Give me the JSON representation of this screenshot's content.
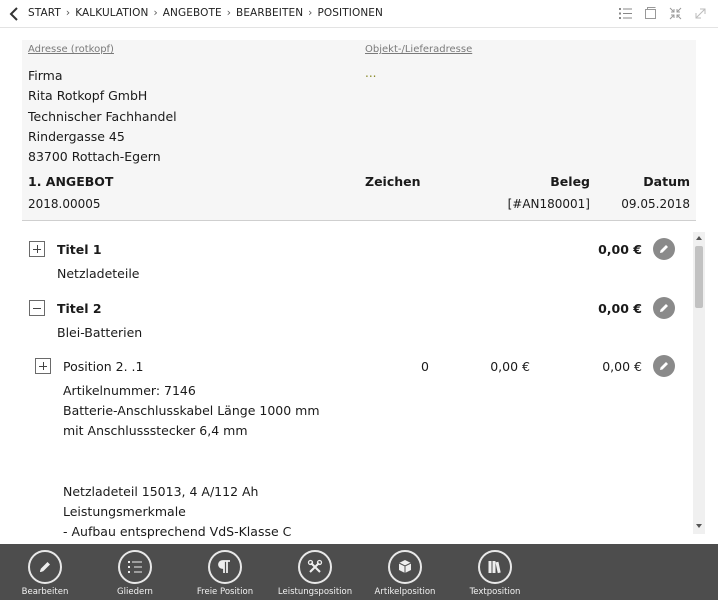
{
  "breadcrumb": {
    "items": [
      "START",
      "KALKULATION",
      "ANGEBOTE",
      "BEARBEITEN",
      "POSITIONEN"
    ],
    "separator": "›"
  },
  "top_icons": [
    "list-icon",
    "window-icon",
    "collapse-icon",
    "expand-icon"
  ],
  "header": {
    "address_label": "Adresse (rotkopf)",
    "object_label": "Objekt-/Lieferadresse",
    "address_lines": [
      "Firma",
      "Rita Rotkopf GmbH",
      "Technischer Fachhandel",
      "Rindergasse 45",
      "83700 Rottach-Egern"
    ],
    "object_value": "...",
    "doc_title": "1. ANGEBOT",
    "col_zeichen": "Zeichen",
    "col_beleg": "Beleg",
    "col_datum": "Datum",
    "doc_number": "2018.00005",
    "beleg_value": "[#AN180001]",
    "datum_value": "09.05.2018"
  },
  "positions": [
    {
      "kind": "title",
      "expanded": false,
      "name": "Titel 1",
      "subtitle": "Netzladeteile",
      "amount": "0,00 €"
    },
    {
      "kind": "title",
      "expanded": true,
      "name": "Titel 2",
      "subtitle": "Blei-Batterien",
      "amount": "0,00 €"
    },
    {
      "kind": "position",
      "expanded": false,
      "name": "Position 2. .1",
      "quantity": "0",
      "unit_price": "0,00 €",
      "amount": "0,00 €",
      "description": "Artikelnummer: 7146\nBatterie-Anschlusskabel Länge 1000 mm\nmit Anschlussstecker 6,4 mm\n\n\nNetzladeteil 15013, 4 A/112 Ah\nLeistungsmerkmale\n- Aufbau entsprechend VdS-Klasse C"
    }
  ],
  "toolbar": [
    {
      "label": "Bearbeiten",
      "icon": "pencil-icon"
    },
    {
      "label": "Gliedern",
      "icon": "outline-icon"
    },
    {
      "label": "Freie Position",
      "icon": "pilcrow-icon"
    },
    {
      "label": "Leistungsposition",
      "icon": "tools-icon"
    },
    {
      "label": "Artikelposition",
      "icon": "boxes-icon"
    },
    {
      "label": "Textposition",
      "icon": "books-icon"
    }
  ],
  "colors": {
    "toolbar_bg": "#4d4d4d",
    "header_bg": "#f6f6f6",
    "edit_button": "#8a8a8a"
  }
}
